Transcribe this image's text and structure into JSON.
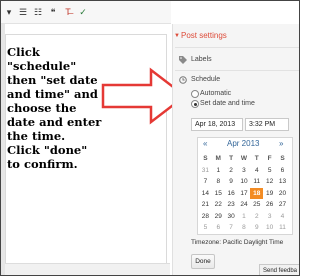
{
  "toolbar": {
    "items": [
      {
        "icon": "dropdown-caret-icon",
        "glyph": "▾"
      },
      {
        "icon": "numbered-list-icon",
        "glyph": "☰"
      },
      {
        "icon": "bulleted-list-icon",
        "glyph": "☷"
      },
      {
        "icon": "quote-icon",
        "glyph": "❝"
      },
      {
        "icon": "remove-formatting-icon",
        "glyph": "T̶"
      },
      {
        "icon": "spellcheck-icon",
        "glyph": "✓"
      }
    ]
  },
  "instruction": "Click\n\"schedule\"\nthen \"set date\nand time\" and\nchoose the\ndate and enter\nthe time.\nClick \"done\"\nto confirm.",
  "panel": {
    "title": "Post settings",
    "labels": "Labels",
    "schedule": "Schedule",
    "options": [
      "Automatic",
      "Set date and time"
    ],
    "selected_option": "Set date and time",
    "date_value": "Apr 18, 2013",
    "time_value": "3:32 PM",
    "timezone": "Timezone: Pacific Daylight Time",
    "done": "Done",
    "feedback": "Send feedba"
  },
  "calendar": {
    "month_label": "Apr 2013",
    "prev": "«",
    "next": "»",
    "days_of_week": [
      "S",
      "M",
      "T",
      "W",
      "T",
      "F",
      "S"
    ],
    "weeks": [
      [
        "31",
        "1",
        "2",
        "3",
        "4",
        "5",
        "6"
      ],
      [
        "7",
        "8",
        "9",
        "10",
        "11",
        "12",
        "13"
      ],
      [
        "14",
        "15",
        "16",
        "17",
        "18",
        "19",
        "20"
      ],
      [
        "21",
        "22",
        "23",
        "24",
        "25",
        "26",
        "27"
      ],
      [
        "28",
        "29",
        "30",
        "1",
        "2",
        "3",
        "4"
      ],
      [
        "5",
        "6",
        "7",
        "8",
        "9",
        "10",
        "11"
      ]
    ],
    "selected_day": "18",
    "colors": {
      "selected": "#f38c24",
      "header": "#336699"
    }
  },
  "colors": {
    "accent": "#dd4b39",
    "arrow": "#e53935"
  }
}
